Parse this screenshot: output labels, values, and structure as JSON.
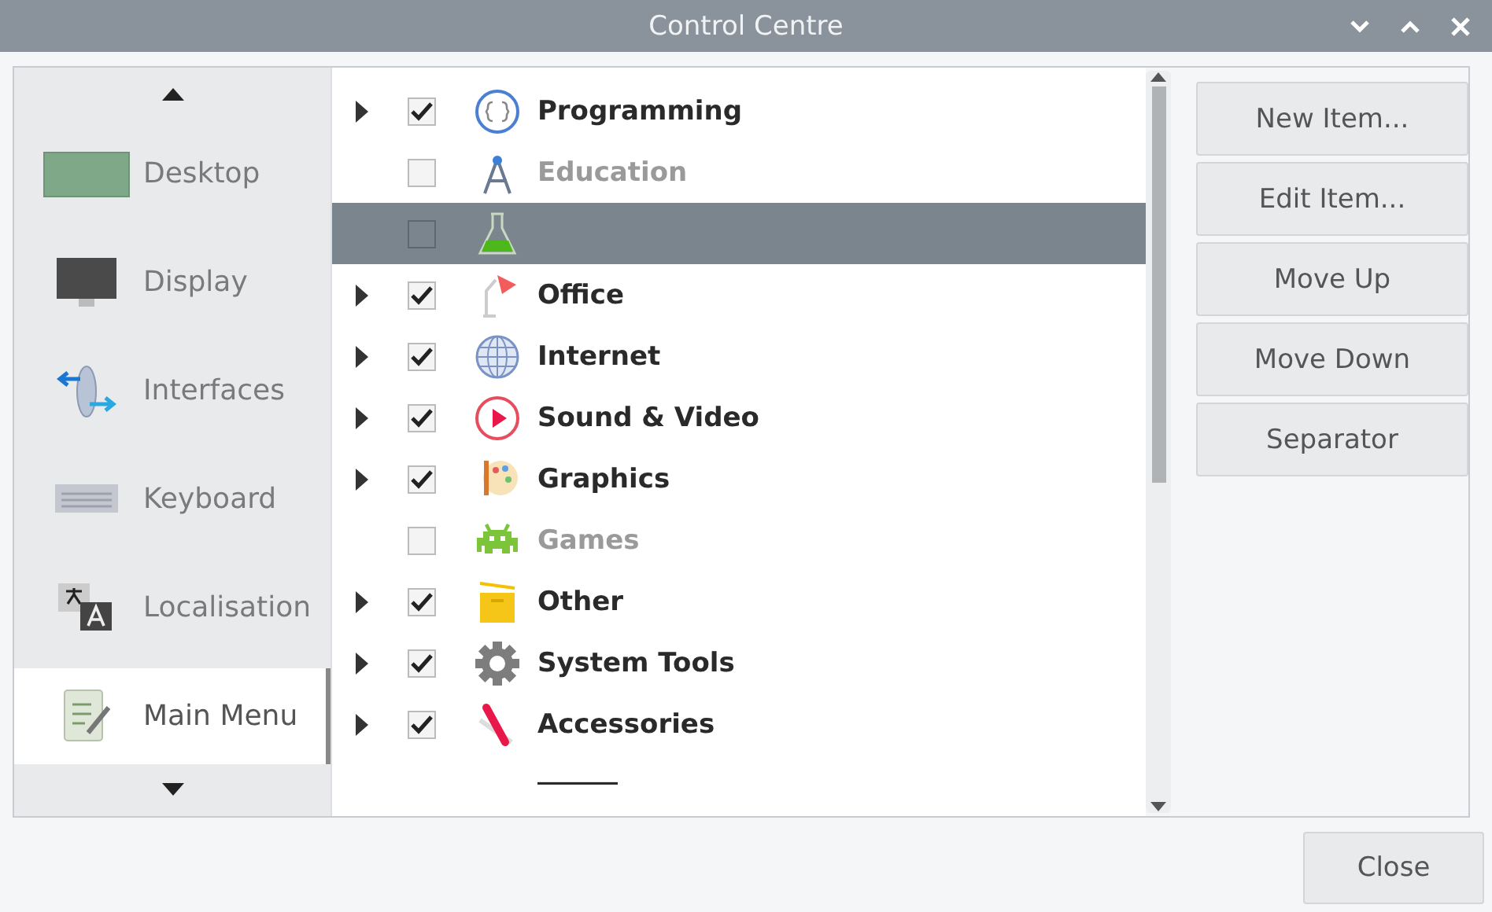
{
  "window": {
    "title": "Control Centre"
  },
  "sidebar": {
    "items": [
      {
        "label": "Desktop",
        "selected": false
      },
      {
        "label": "Display",
        "selected": false
      },
      {
        "label": "Interfaces",
        "selected": false
      },
      {
        "label": "Keyboard",
        "selected": false
      },
      {
        "label": "Localisation",
        "selected": false
      },
      {
        "label": "Main Menu",
        "selected": true
      }
    ]
  },
  "menu_tree": {
    "rows": [
      {
        "label": "Programming",
        "expandable": true,
        "checked": true,
        "selected": false
      },
      {
        "label": "Education",
        "expandable": false,
        "checked": false,
        "selected": false
      },
      {
        "label": "",
        "expandable": false,
        "checked": false,
        "selected": true
      },
      {
        "label": "Office",
        "expandable": true,
        "checked": true,
        "selected": false
      },
      {
        "label": "Internet",
        "expandable": true,
        "checked": true,
        "selected": false
      },
      {
        "label": "Sound & Video",
        "expandable": true,
        "checked": true,
        "selected": false
      },
      {
        "label": "Graphics",
        "expandable": true,
        "checked": true,
        "selected": false
      },
      {
        "label": "Games",
        "expandable": false,
        "checked": false,
        "selected": false
      },
      {
        "label": "Other",
        "expandable": true,
        "checked": true,
        "selected": false
      },
      {
        "label": "System Tools",
        "expandable": true,
        "checked": true,
        "selected": false
      },
      {
        "label": "Accessories",
        "expandable": true,
        "checked": true,
        "selected": false
      },
      {
        "label": "______",
        "kind": "separator"
      }
    ]
  },
  "buttons": [
    "New Item...",
    "Edit Item...",
    "Move Up",
    "Move Down",
    "Separator"
  ],
  "footer": {
    "close": "Close"
  }
}
